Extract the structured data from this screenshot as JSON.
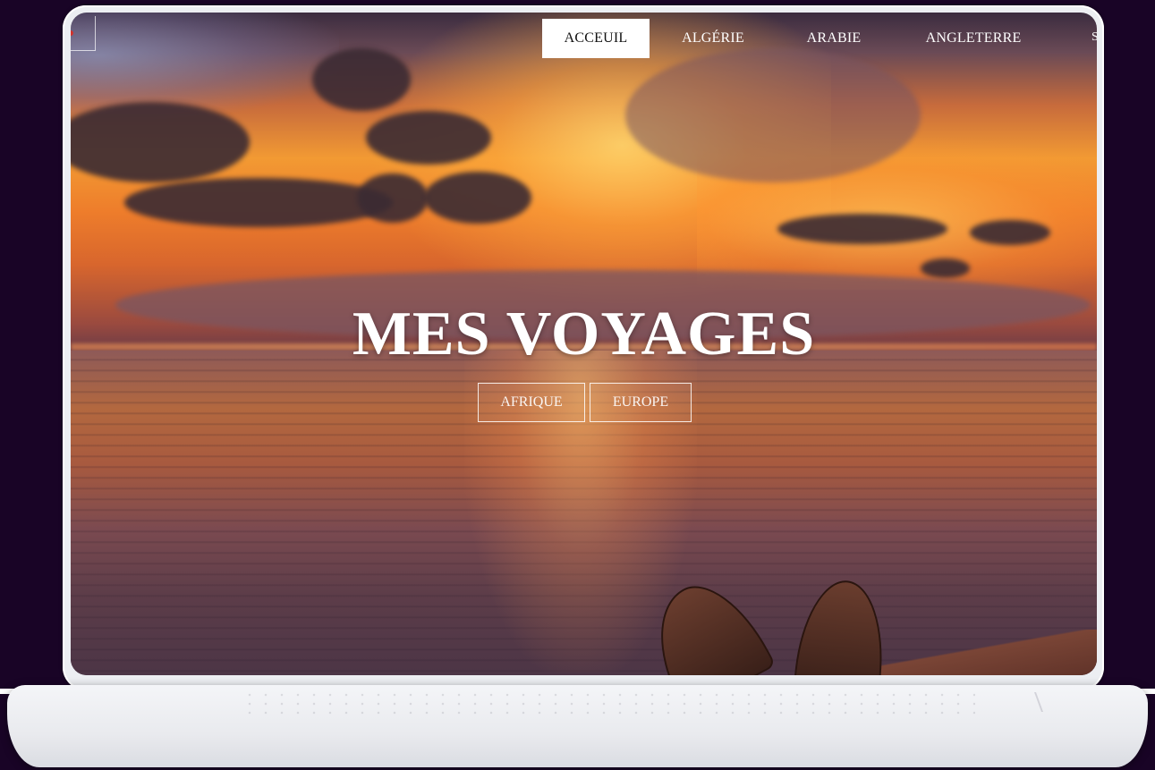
{
  "nav": {
    "items": [
      {
        "label": "ACCEUIL",
        "active": true
      },
      {
        "label": "ALGÉRIE",
        "active": false
      },
      {
        "label": "ARABIE",
        "active": false
      },
      {
        "label": "ANGLETERRE",
        "active": false
      }
    ],
    "edge_fragment": "S"
  },
  "hero": {
    "title": "MES VOYAGES",
    "buttons": [
      {
        "label": "AFRIQUE"
      },
      {
        "label": "EUROPE"
      }
    ]
  },
  "colors": {
    "page_background": "#190426",
    "nav_active_background": "#ffffff",
    "text": "#ffffff"
  },
  "icons": [
    "logo-dot-icon"
  ]
}
